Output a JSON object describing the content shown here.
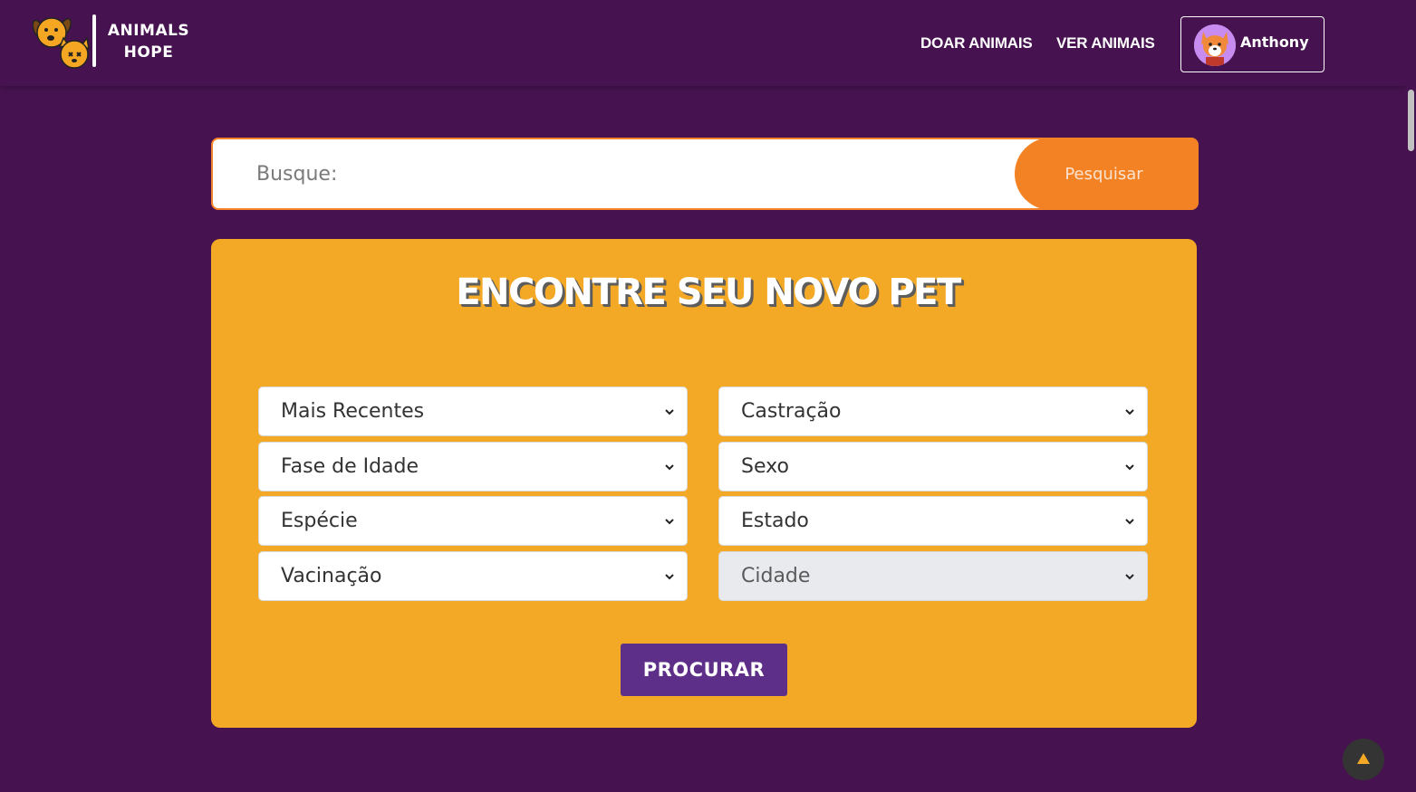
{
  "header": {
    "logo_line1": "ANIMALS",
    "logo_line2": "HOPE",
    "nav": [
      {
        "label": "DOAR ANIMAIS"
      },
      {
        "label": "VER ANIMAIS"
      }
    ],
    "user": {
      "name": "Anthony"
    }
  },
  "search": {
    "placeholder": "Busque:",
    "button_label": "Pesquisar"
  },
  "filters": {
    "title": "ENCONTRE SEU NOVO PET",
    "selects": [
      {
        "label": "Mais Recentes"
      },
      {
        "label": "Castração"
      },
      {
        "label": "Fase de Idade"
      },
      {
        "label": "Sexo"
      },
      {
        "label": "Espécie"
      },
      {
        "label": "Estado"
      },
      {
        "label": "Vacinação"
      },
      {
        "label": "Cidade",
        "disabled": true
      }
    ],
    "submit_label": "PROCURAR"
  },
  "colors": {
    "background": "#461350",
    "accent_orange": "#f38225",
    "panel_yellow": "#f3a926",
    "button_purple": "#5e2f88"
  },
  "icons": [
    "dog-cat-logo-icon",
    "corgi-avatar-icon",
    "chevron-down-icon",
    "arrow-up-icon"
  ]
}
